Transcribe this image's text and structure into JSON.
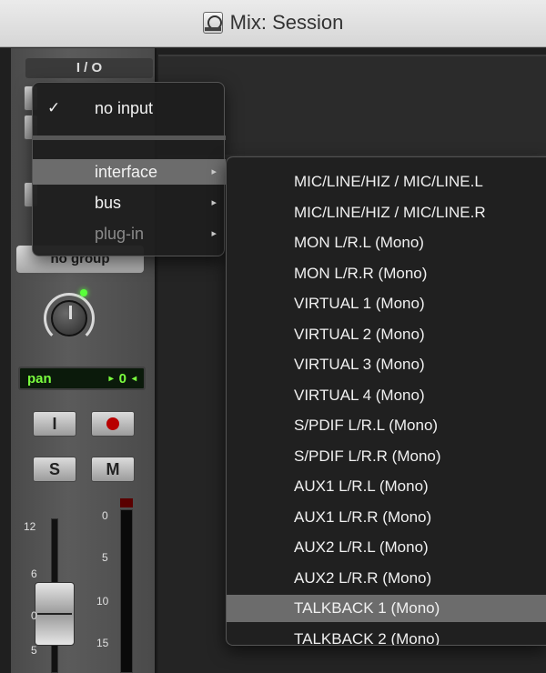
{
  "window": {
    "title": "Mix: Session"
  },
  "strip": {
    "io_header": "I / O",
    "group": "no group",
    "pan": {
      "label": "pan",
      "value": "0"
    },
    "buttons": {
      "input": "I",
      "solo": "S",
      "mute": "M"
    },
    "fader_scale": [
      "12",
      "6",
      "0",
      "5"
    ],
    "meter_scale": [
      "0",
      "5",
      "10",
      "15"
    ],
    "knob_led_color": "#59ff3a"
  },
  "menu": {
    "items": [
      {
        "label": "no input",
        "checked": true,
        "has_submenu": false,
        "enabled": true
      },
      {
        "label": "interface",
        "checked": false,
        "has_submenu": true,
        "enabled": true,
        "highlighted": true
      },
      {
        "label": "bus",
        "checked": false,
        "has_submenu": true,
        "enabled": true
      },
      {
        "label": "plug-in",
        "checked": false,
        "has_submenu": true,
        "enabled": false
      }
    ],
    "check_glyph": "✓",
    "arrow_glyph": "▸"
  },
  "submenu": {
    "items": [
      "MIC/LINE/HIZ / MIC/LINE.L",
      "MIC/LINE/HIZ / MIC/LINE.R",
      "MON L/R.L (Mono)",
      "MON L/R.R (Mono)",
      "VIRTUAL 1 (Mono)",
      "VIRTUAL 2 (Mono)",
      "VIRTUAL 3 (Mono)",
      "VIRTUAL 4 (Mono)",
      "S/PDIF L/R.L (Mono)",
      "S/PDIF L/R.R (Mono)",
      "AUX1 L/R.L (Mono)",
      "AUX1 L/R.R (Mono)",
      "AUX2 L/R.L (Mono)",
      "AUX2 L/R.R (Mono)",
      "TALKBACK 1 (Mono)",
      "TALKBACK 2 (Mono)"
    ],
    "highlighted_index": 14
  }
}
